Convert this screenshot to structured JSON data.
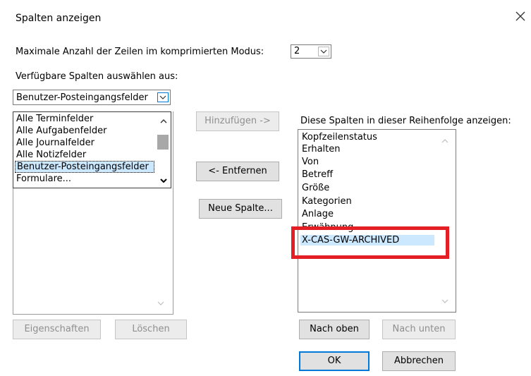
{
  "dialog": {
    "title": "Spalten anzeigen",
    "close_icon": "close-icon"
  },
  "rows_mode": {
    "label": "Maximale Anzahl der Zeilen im komprimierten Modus:",
    "value": "2"
  },
  "available": {
    "label": "Verfügbare Spalten auswählen aus:",
    "selected": "Benutzer-Posteingangsfelder",
    "items": [
      "Alle Terminfelder",
      "Alle Aufgabenfelder",
      "Alle Journalfelder",
      "Alle Notizfelder",
      "Benutzer-Posteingangsfelder",
      "Formulare..."
    ]
  },
  "buttons": {
    "add": "Hinzufügen ->",
    "remove": "<- Entfernen",
    "new_column": "Neue Spalte...",
    "properties": "Eigenschaften",
    "delete": "Löschen",
    "move_up": "Nach oben",
    "move_down": "Nach unten",
    "ok": "OK",
    "cancel": "Abbrechen"
  },
  "shown": {
    "label": "Diese Spalten in dieser Reihenfolge anzeigen:",
    "items": [
      "Kopfzeilenstatus",
      "Erhalten",
      "Von",
      "Betreff",
      "Größe",
      "Kategorien",
      "Anlage",
      "Erwähnung",
      "X-CAS-GW-ARCHIVED"
    ]
  },
  "colors": {
    "selection": "#cce8ff",
    "highlight_box": "#e31e24",
    "default_button_border": "#0078d7"
  }
}
